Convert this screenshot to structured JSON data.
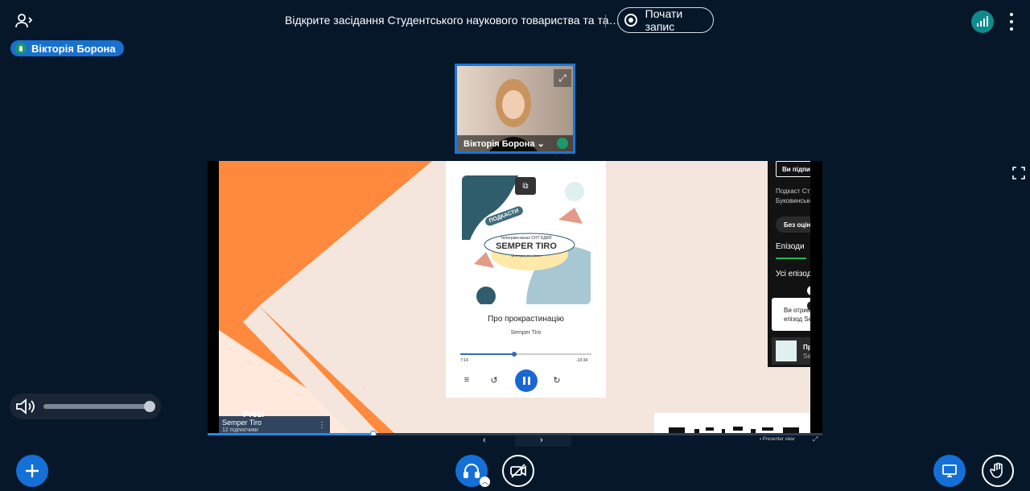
{
  "header": {
    "meeting_title": "Відкрите засідання Студентського наукового товариства та та…",
    "record_label": "Почати запис"
  },
  "presenter": {
    "name": "Вікторія Борона"
  },
  "webcam": {
    "name": "Вікторія Борона ⌄"
  },
  "podcast_player": {
    "cover_title": "SEMPER TIRO",
    "cover_badge": "ПОДКАСТИ",
    "cover_caption": "Телеграм-канал СНТ БДМУ",
    "cover_handle": "@semper_tiro_bsmu",
    "track_title": "Про прокрастинацію",
    "track_artist": "Semper Tiro",
    "time_elapsed": "7:14",
    "time_remaining": "-10:34",
    "progress": 0.41
  },
  "spotify_panel": {
    "subscribed_label": "Ви підписал",
    "podcast_line1": "Подкаст Студ",
    "podcast_line2": "Буковинськог",
    "rating_label": "Без оцінк",
    "tab_episodes": "Епізоди",
    "all_episodes": "Усі епізоди",
    "toast_line1": "Ви отримає",
    "toast_line2": "епізод Semp",
    "item_title": "Про п",
    "item_subtitle": "Semp"
  },
  "prezi": {
    "logo": "Prezi",
    "card_title": "Semper Tiro",
    "card_subtitle": "12 підписчики",
    "menu": "⋮"
  },
  "presentation": {
    "progress": 0.27,
    "view_label": "Presenter view",
    "prev": "‹",
    "next": "›"
  },
  "volume": {
    "level": 1.0
  },
  "colors": {
    "bg": "#06172a",
    "accent_blue": "#1470d6",
    "mic_green": "#1b9968",
    "slide_orange": "#ff8a3d"
  }
}
